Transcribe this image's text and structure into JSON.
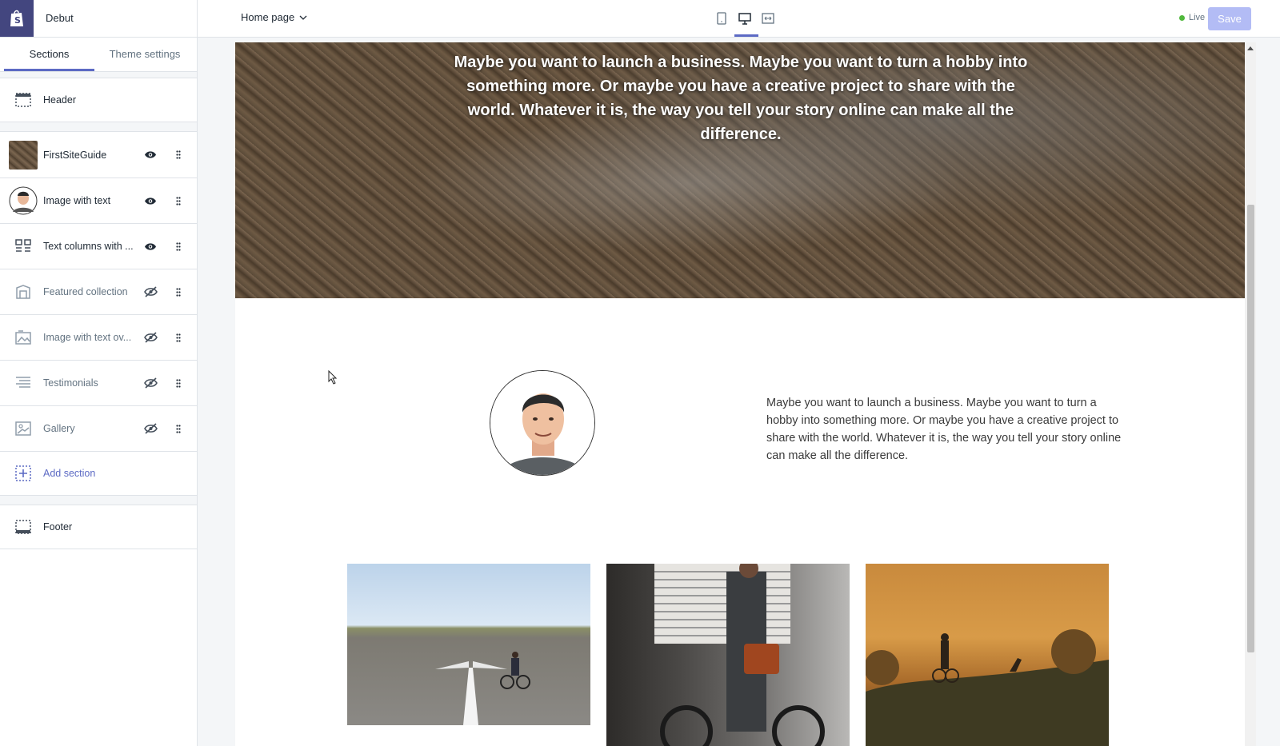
{
  "topbar": {
    "theme_name": "Debut",
    "page_select": "Home page",
    "live_label": "Live",
    "save_label": "Save"
  },
  "sidebar": {
    "tabs": [
      {
        "label": "Sections",
        "active": true
      },
      {
        "label": "Theme settings",
        "active": false
      }
    ],
    "header_item": {
      "label": "Header",
      "icon": "header-layout-icon"
    },
    "items": [
      {
        "label": "FirstSiteGuide",
        "icon": "thumbnail-image",
        "visible": true
      },
      {
        "label": "Image with text",
        "icon": "thumbnail-portrait",
        "visible": true
      },
      {
        "label": "Text columns with ...",
        "icon": "text-columns-icon",
        "visible": true
      },
      {
        "label": "Featured collection",
        "icon": "collection-icon",
        "visible": false
      },
      {
        "label": "Image with text ov...",
        "icon": "image-overlay-icon",
        "visible": false
      },
      {
        "label": "Testimonials",
        "icon": "testimonials-icon",
        "visible": false
      },
      {
        "label": "Gallery",
        "icon": "gallery-icon",
        "visible": false
      }
    ],
    "add_section": {
      "label": "Add section",
      "icon": "add-section-icon"
    },
    "footer_item": {
      "label": "Footer",
      "icon": "footer-layout-icon"
    }
  },
  "preview": {
    "hero_text": "Maybe you want to launch a business. Maybe you want to turn a hobby into something more. Or maybe you have a creative project to share with the world. Whatever it is, the way you tell your story online can make all the difference.",
    "about_text": "Maybe you want to launch a business. Maybe you want to turn a hobby into something more. Or maybe you have a creative project to share with the world. Whatever it is, the way you tell your story online can make all the difference."
  },
  "colors": {
    "accent": "#5c6ac4",
    "logo_bg": "#43467f",
    "save_disabled": "#b3bcf5",
    "live_dot": "#50b83c"
  }
}
